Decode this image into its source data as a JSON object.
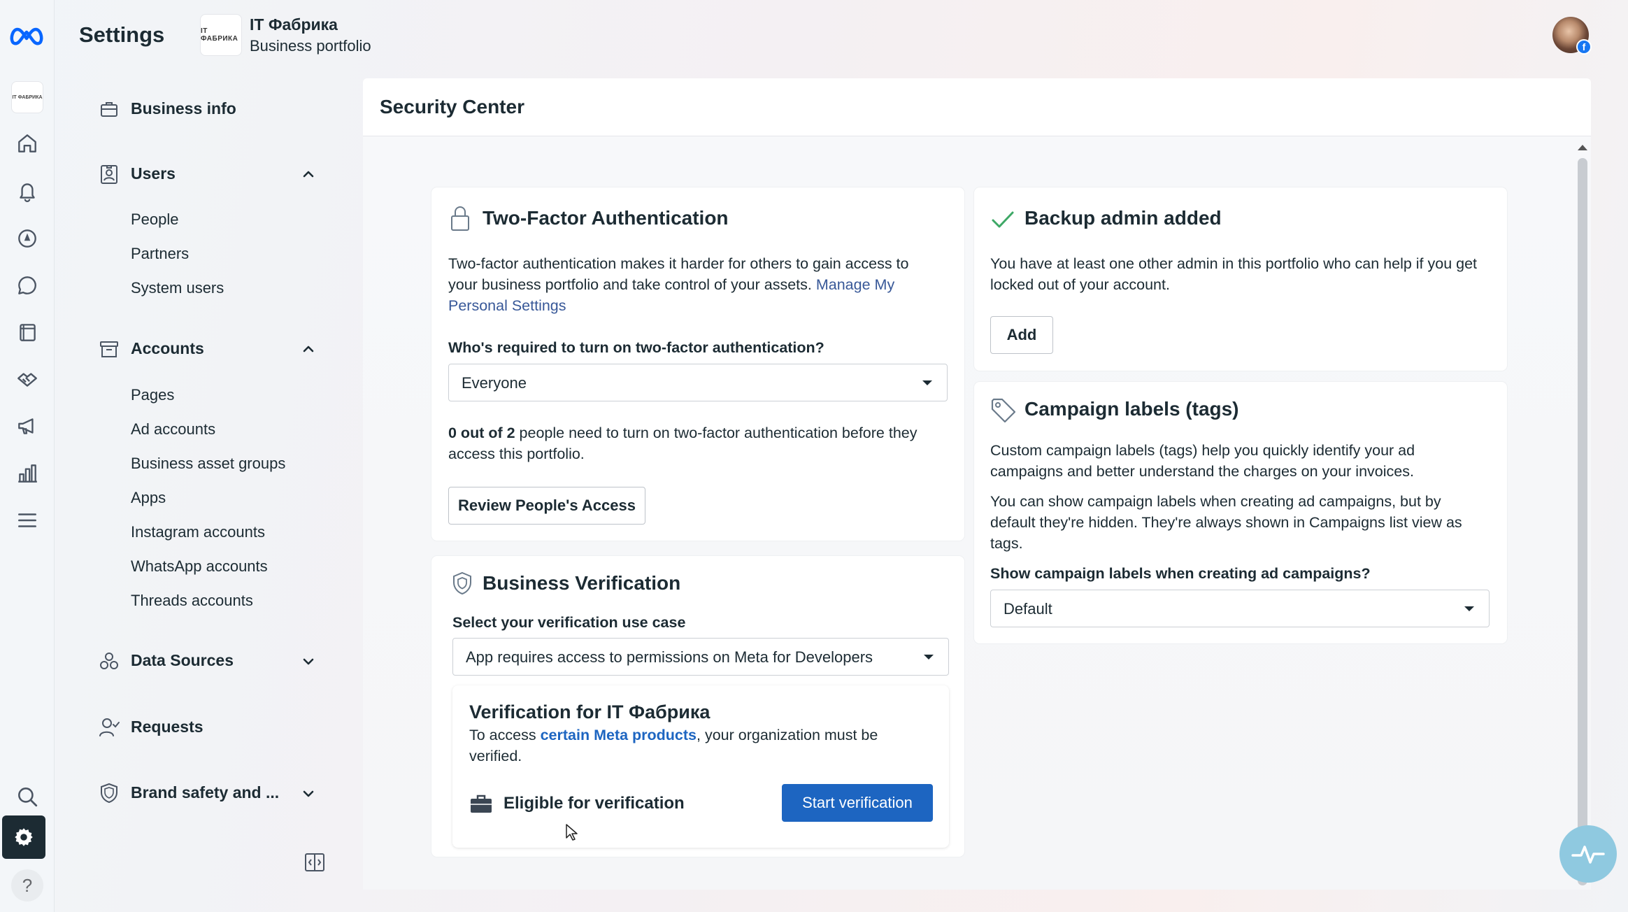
{
  "header": {
    "title": "Settings",
    "business_name": "IT Фабрика",
    "business_subtitle": "Business portfolio",
    "logo_text": "IT ФАБРИКА"
  },
  "sidebar": {
    "business_info": "Business info",
    "users": {
      "label": "Users",
      "items": [
        "People",
        "Partners",
        "System users"
      ]
    },
    "accounts": {
      "label": "Accounts",
      "items": [
        "Pages",
        "Ad accounts",
        "Business asset groups",
        "Apps",
        "Instagram accounts",
        "WhatsApp accounts",
        "Threads accounts"
      ]
    },
    "data_sources": "Data Sources",
    "requests": "Requests",
    "brand_safety": "Brand safety and ..."
  },
  "main": {
    "title": "Security Center",
    "two_factor": {
      "title": "Two-Factor Authentication",
      "desc_line1": "Two-factor authentication makes it harder for others to gain access to",
      "desc_line2": "your business portfolio and take control of your assets.",
      "link_part1": "Manage My",
      "link_part2": "Personal Settings",
      "question": "Who's required to turn on two-factor authentication?",
      "selected": "Everyone",
      "status_bold": "0 out of 2",
      "status_rest": "people need to turn on two-factor authentication before they",
      "status_line2": "access this portfolio.",
      "review_button": "Review People's Access"
    },
    "business_verification": {
      "title": "Business Verification",
      "use_case_label": "Select your verification use case",
      "use_case_selected": "App requires access to permissions on Meta for Developers",
      "panel_title": "Verification for IT Фабрика",
      "panel_text_pre": "To access",
      "panel_link": "certain Meta products",
      "panel_text_post": ", your organization must be",
      "panel_text_line2": "verified.",
      "eligible_label": "Eligible for verification",
      "start_button": "Start verification"
    },
    "backup_admin": {
      "title": "Backup admin added",
      "desc_line1": "You have at least one other admin in this portfolio who can help if you get",
      "desc_line2": "locked out of your account.",
      "add_button": "Add"
    },
    "campaign_labels": {
      "title": "Campaign labels (tags)",
      "desc1_line1": "Custom campaign labels (tags) help you quickly identify your ad",
      "desc1_line2": "campaigns and better understand the charges on your invoices.",
      "desc2_line1": "You can show campaign labels when creating ad campaigns, but by",
      "desc2_line2": "default they're hidden. They're always shown in Campaigns list view as",
      "desc2_line3": "tags.",
      "question": "Show campaign labels when creating ad campaigns?",
      "selected": "Default"
    }
  },
  "rail": {
    "help": "?"
  },
  "colors": {
    "accent": "#1d65c1",
    "link": "#385898",
    "meta_blue": "#0866ff",
    "settings_active": "#1c2b33"
  }
}
